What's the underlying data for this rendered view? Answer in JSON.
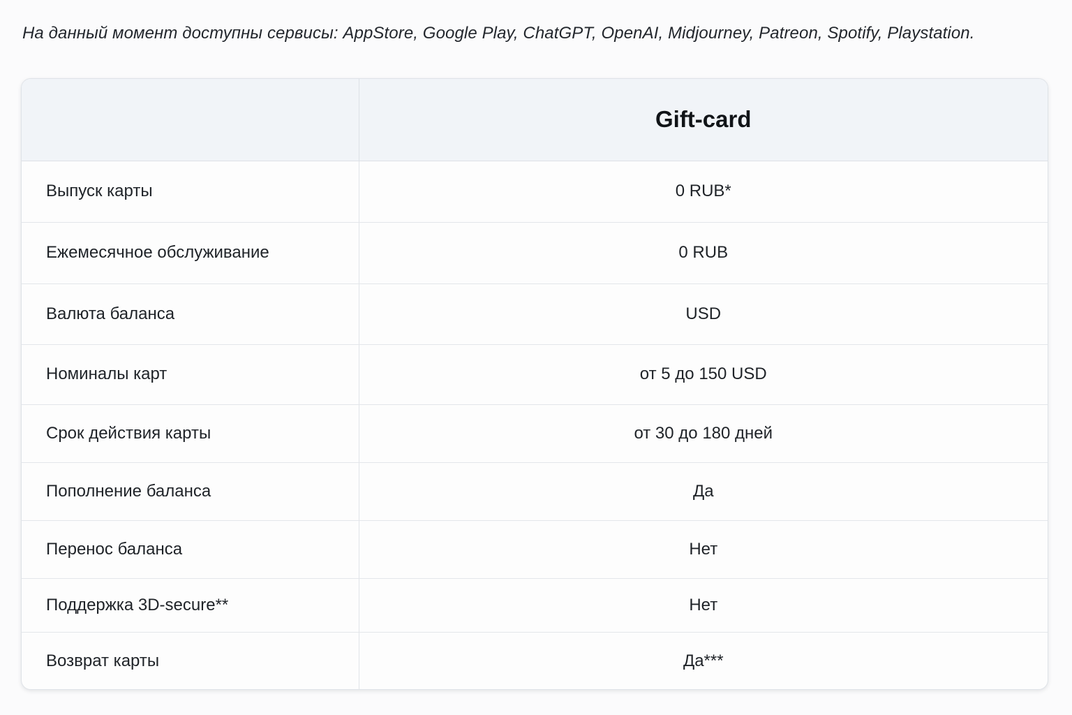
{
  "intro_text": "На данный момент доступны сервисы: AppStore, Google Play, ChatGPT, OpenAI, Midjourney, Patreon, Spotify, Playstation.",
  "table": {
    "header": {
      "column_title": "Gift-card"
    },
    "rows": [
      {
        "label": "Выпуск карты",
        "value": "0 RUB*"
      },
      {
        "label": "Ежемесячное обслуживание",
        "value": "0 RUB"
      },
      {
        "label": "Валюта баланса",
        "value": "USD"
      },
      {
        "label": "Номиналы карт",
        "value": "от 5 до 150 USD"
      },
      {
        "label": "Срок действия карты",
        "value": "от 30 до 180 дней"
      },
      {
        "label": "Пополнение баланса",
        "value": "Да"
      },
      {
        "label": "Перенос баланса",
        "value": "Нет"
      },
      {
        "label": "Поддержка 3D-secure**",
        "value": "Нет"
      },
      {
        "label": "Возврат карты",
        "value": "Да***"
      }
    ]
  }
}
